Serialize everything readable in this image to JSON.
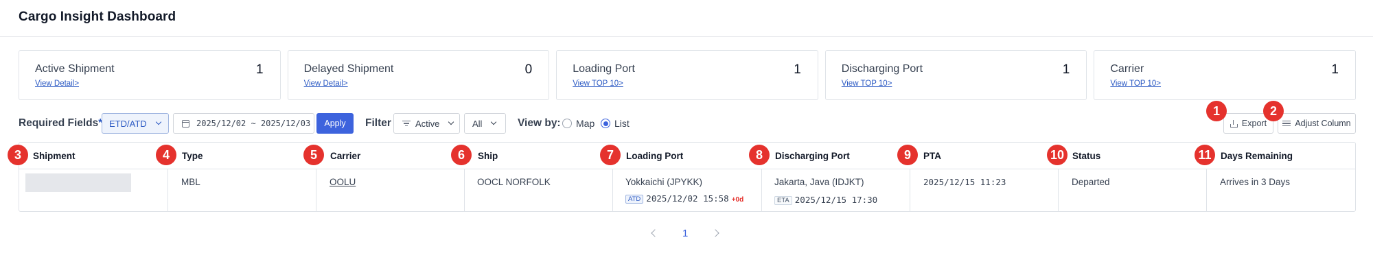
{
  "header": {
    "title": "Cargo Insight Dashboard"
  },
  "cards": [
    {
      "title": "Active Shipment",
      "link": "View Detail>",
      "count": "1"
    },
    {
      "title": "Delayed Shipment",
      "link": "View Detail>",
      "count": "0"
    },
    {
      "title": "Loading Port",
      "link": "View TOP 10>",
      "count": "1"
    },
    {
      "title": "Discharging Port",
      "link": "View TOP 10>",
      "count": "1"
    },
    {
      "title": "Carrier",
      "link": "View TOP 10>",
      "count": "1"
    }
  ],
  "toolbar": {
    "required_label": "Required Fields",
    "required_star": "*",
    "date_type": "ETD/ATD",
    "date_range": "2025/12/02 ~ 2025/12/03",
    "apply_label": "Apply",
    "filter_label": "Filter",
    "filter_status": "Active",
    "filter_scope": "All",
    "viewby_label": "View by:",
    "view_options": [
      "Map",
      "List"
    ],
    "view_selected": "List",
    "export_label": "Export",
    "adjust_label": "Adjust Column"
  },
  "badges": [
    "1",
    "2",
    "3",
    "4",
    "5",
    "6",
    "7",
    "8",
    "9",
    "10",
    "11"
  ],
  "table": {
    "columns": [
      "Shipment",
      "Type",
      "Carrier",
      "Ship",
      "Loading Port",
      "Discharging Port",
      "PTA",
      "Status",
      "Days Remaining"
    ],
    "rows": [
      {
        "shipment": "",
        "type": "MBL",
        "carrier": "OOLU",
        "ship": "OOCL NORFOLK",
        "loading_port": "Yokkaichi (JPYKK)",
        "loading_tag": "ATD",
        "loading_time": "2025/12/02 15:58",
        "loading_offset": "+0d",
        "discharging_port": "Jakarta, Java (IDJKT)",
        "discharging_tag": "ETA",
        "discharging_time": "2025/12/15 17:30",
        "pta": "2025/12/15 11:23",
        "status": "Departed",
        "days_remaining": "Arrives in 3 Days"
      }
    ]
  },
  "pagination": {
    "current": "1"
  },
  "colors": {
    "accent": "#3d63dd",
    "badge": "#e5322d",
    "link": "#2b59c3"
  }
}
